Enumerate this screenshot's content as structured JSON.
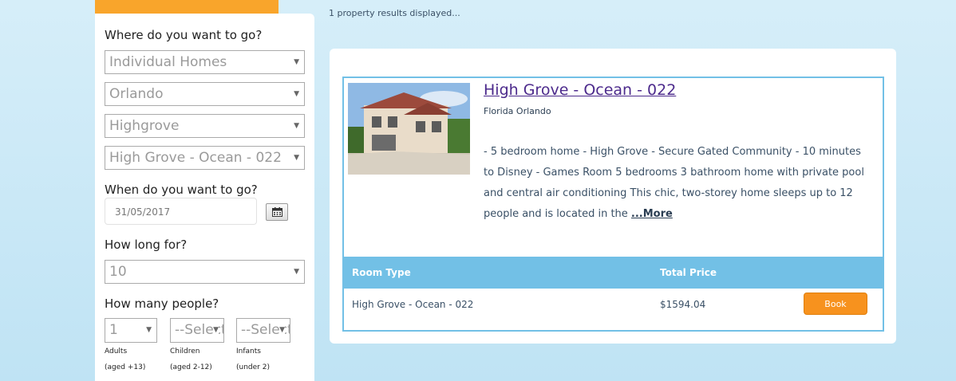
{
  "search": {
    "where_label": "Where do you want to go?",
    "type_value": "Individual Homes",
    "city_value": "Orlando",
    "community_value": "Highgrove",
    "property_value": "High Grove - Ocean - 022",
    "when_label": "When do you want to go?",
    "date_value": "31/05/2017",
    "howlong_label": "How long for?",
    "nights_value": "10",
    "people_label": "How many people?",
    "adults_value": "1",
    "children_value": "--Select--",
    "infants_value": "--Select--",
    "adults_label": "Adults",
    "adults_sub": "(aged +13)",
    "children_label": "Children",
    "children_sub": "(aged 2-12)",
    "infants_label": "Infants",
    "infants_sub": "(under 2)"
  },
  "results": {
    "count_text": "1 property results displayed...",
    "property": {
      "title": "High Grove - Ocean - 022",
      "location": "Florida Orlando",
      "description": "- 5 bedroom home - High Grove - Secure Gated Community - 10 minutes to Disney - Games Room 5 bedrooms 3 bathroom home with private pool and central air conditioning This chic, two-storey home sleeps up to 12 people and is located in the ",
      "more_label": "...More"
    },
    "table": {
      "col_room": "Room Type",
      "col_price": "Total Price",
      "row_room": "High Grove - Ocean - 022",
      "row_price": "$1594.04",
      "book_label": "Book"
    }
  },
  "colors": {
    "accent_orange": "#f9a52b",
    "table_header": "#72c0e6",
    "book_button": "#f7921e"
  }
}
